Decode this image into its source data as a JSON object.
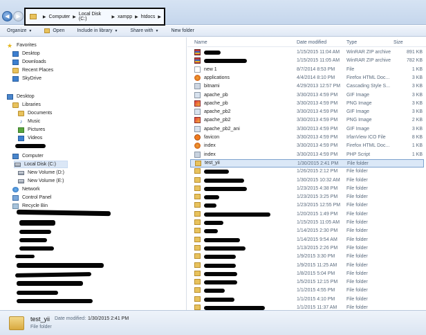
{
  "address_bar": {
    "crumbs": [
      "Computer",
      "Local Disk (C:)",
      "xampp",
      "htdocs"
    ]
  },
  "toolbar": {
    "organize": "Organize",
    "open": "Open",
    "include_in_library": "Include in library",
    "share_with": "Share with",
    "new_folder": "New folder"
  },
  "nav": {
    "favorites": "Favorites",
    "desktop_fav": "Desktop",
    "downloads": "Downloads",
    "recent_places": "Recent Places",
    "skydrive": "SkyDrive",
    "desktop": "Desktop",
    "libraries": "Libraries",
    "documents": "Documents",
    "music": "Music",
    "pictures": "Pictures",
    "videos": "Videos",
    "computer": "Computer",
    "local_disk_c": "Local Disk (C:)",
    "new_volume_d": "New Volume (D:)",
    "new_volume_e": "New Volume (E:)",
    "network": "Network",
    "control_panel": "Control Panel",
    "recycle_bin": "Recycle Bin"
  },
  "columns": {
    "name": "Name",
    "date_modified": "Date modified",
    "type": "Type",
    "size": "Size"
  },
  "files": [
    {
      "name": "",
      "date": "1/15/2015 11:04 AM",
      "type": "WinRAR ZIP archive",
      "size": "891 KB",
      "icon": "zip-icon"
    },
    {
      "name": "",
      "date": "1/15/2015 11:05 AM",
      "type": "WinRAR ZIP archive",
      "size": "782 KB",
      "icon": "zip-icon"
    },
    {
      "name": "new 1",
      "date": "8/7/2014 8:53 PM",
      "type": "File",
      "size": "1 KB",
      "icon": "file-icon"
    },
    {
      "name": "applications",
      "date": "4/4/2014 8:10 PM",
      "type": "Firefox HTML Doc...",
      "size": "3 KB",
      "icon": "firefox-icon"
    },
    {
      "name": "bitnami",
      "date": "4/29/2013 12:57 PM",
      "type": "Cascading Style S...",
      "size": "3 KB",
      "icon": "css-icon"
    },
    {
      "name": "apache_pb",
      "date": "3/30/2013 4:59 PM",
      "type": "GIF Image",
      "size": "3 KB",
      "icon": "gif-icon"
    },
    {
      "name": "apache_pb",
      "date": "3/30/2013 4:59 PM",
      "type": "PNG Image",
      "size": "3 KB",
      "icon": "png-icon"
    },
    {
      "name": "apache_pb2",
      "date": "3/30/2013 4:59 PM",
      "type": "GIF Image",
      "size": "3 KB",
      "icon": "gif-icon"
    },
    {
      "name": "apache_pb2",
      "date": "3/30/2013 4:59 PM",
      "type": "PNG Image",
      "size": "2 KB",
      "icon": "png-icon"
    },
    {
      "name": "apache_pb2_ani",
      "date": "3/30/2013 4:59 PM",
      "type": "GIF Image",
      "size": "3 KB",
      "icon": "gif-icon"
    },
    {
      "name": "favicon",
      "date": "3/30/2013 4:59 PM",
      "type": "IrfanView ICO File",
      "size": "8 KB",
      "icon": "ico-icon"
    },
    {
      "name": "index",
      "date": "3/30/2013 4:59 PM",
      "type": "Firefox HTML Doc...",
      "size": "1 KB",
      "icon": "firefox-icon"
    },
    {
      "name": "index",
      "date": "3/30/2013 4:59 PM",
      "type": "PHP Script",
      "size": "1 KB",
      "icon": "php-icon"
    },
    {
      "name": "test_yii",
      "date": "1/30/2015 2:41 PM",
      "type": "File folder",
      "size": "",
      "icon": "folder-icon"
    },
    {
      "name": "",
      "date": "1/26/2015 2:12 PM",
      "type": "File folder",
      "size": "",
      "icon": "folder-icon"
    },
    {
      "name": "",
      "date": "1/30/2015 10:32 AM",
      "type": "File folder",
      "size": "",
      "icon": "folder-icon"
    },
    {
      "name": "",
      "date": "1/23/2015 4:38 PM",
      "type": "File folder",
      "size": "",
      "icon": "folder-icon"
    },
    {
      "name": "",
      "date": "1/23/2015 3:25 PM",
      "type": "File folder",
      "size": "",
      "icon": "folder-icon"
    },
    {
      "name": "",
      "date": "1/23/2015 12:55 PM",
      "type": "File folder",
      "size": "",
      "icon": "folder-icon"
    },
    {
      "name": "",
      "date": "1/20/2015 1:49 PM",
      "type": "File folder",
      "size": "",
      "icon": "folder-icon"
    },
    {
      "name": "",
      "date": "1/15/2015 11:05 AM",
      "type": "File folder",
      "size": "",
      "icon": "folder-icon"
    },
    {
      "name": "",
      "date": "1/14/2015 2:30 PM",
      "type": "File folder",
      "size": "",
      "icon": "folder-icon"
    },
    {
      "name": "",
      "date": "1/14/2015 9:54 AM",
      "type": "File folder",
      "size": "",
      "icon": "folder-icon"
    },
    {
      "name": "",
      "date": "1/13/2015 2:26 PM",
      "type": "File folder",
      "size": "",
      "icon": "folder-icon"
    },
    {
      "name": "",
      "date": "1/9/2015 3:30 PM",
      "type": "File folder",
      "size": "",
      "icon": "folder-icon"
    },
    {
      "name": "",
      "date": "1/9/2015 11:25 AM",
      "type": "File folder",
      "size": "",
      "icon": "folder-icon"
    },
    {
      "name": "",
      "date": "1/8/2015 5:04 PM",
      "type": "File folder",
      "size": "",
      "icon": "folder-icon"
    },
    {
      "name": "",
      "date": "1/5/2015 12:15 PM",
      "type": "File folder",
      "size": "",
      "icon": "folder-icon"
    },
    {
      "name": "",
      "date": "1/1/2015 4:55 PM",
      "type": "File folder",
      "size": "",
      "icon": "folder-icon"
    },
    {
      "name": "",
      "date": "1/1/2015 4:10 PM",
      "type": "File folder",
      "size": "",
      "icon": "folder-icon"
    },
    {
      "name": "",
      "date": "1/1/2015 11:37 AM",
      "type": "File folder",
      "size": "",
      "icon": "folder-icon"
    }
  ],
  "details": {
    "name": "test_yii",
    "date_label": "Date modified:",
    "date_value": "1/30/2015 2:41 PM",
    "type": "File folder"
  }
}
